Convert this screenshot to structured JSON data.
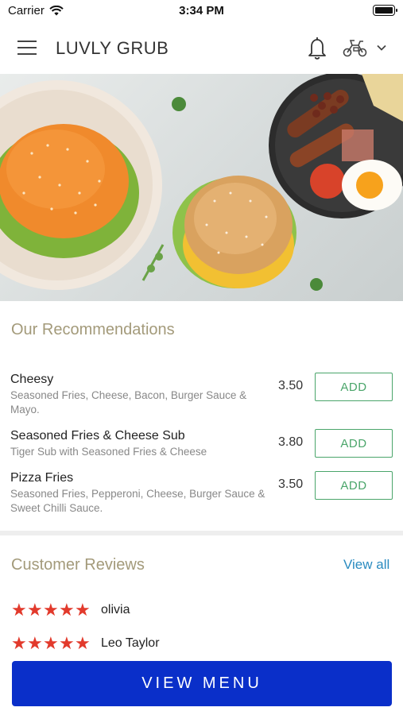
{
  "status_bar": {
    "carrier": "Carrier",
    "time": "3:34 PM"
  },
  "header": {
    "title": "LUVLY GRUB"
  },
  "recommendations": {
    "title": "Our Recommendations",
    "items": [
      {
        "name": "Cheesy",
        "desc": "Seasoned Fries, Cheese, Bacon, Burger Sauce & Mayo.",
        "price": "3.50",
        "button": "ADD"
      },
      {
        "name": "Seasoned Fries & Cheese Sub",
        "desc": "Tiger Sub with Seasoned Fries & Cheese",
        "price": "3.80",
        "button": "ADD"
      },
      {
        "name": "Pizza Fries",
        "desc": "Seasoned Fries, Pepperoni, Cheese, Burger Sauce & Sweet Chilli Sauce.",
        "price": "3.50",
        "button": "ADD"
      }
    ]
  },
  "reviews": {
    "title": "Customer Reviews",
    "view_all": "View all",
    "items": [
      {
        "name": "olivia",
        "rating": 5
      },
      {
        "name": "Leo Taylor",
        "rating": 5
      }
    ]
  },
  "footer": {
    "button": "VIEW MENU"
  },
  "colors": {
    "accent_title": "#a39a7a",
    "add_green": "#4aa56a",
    "link_blue": "#2a8bc0",
    "cta_blue": "#0a2fc9",
    "star_red": "#e23a2c"
  }
}
